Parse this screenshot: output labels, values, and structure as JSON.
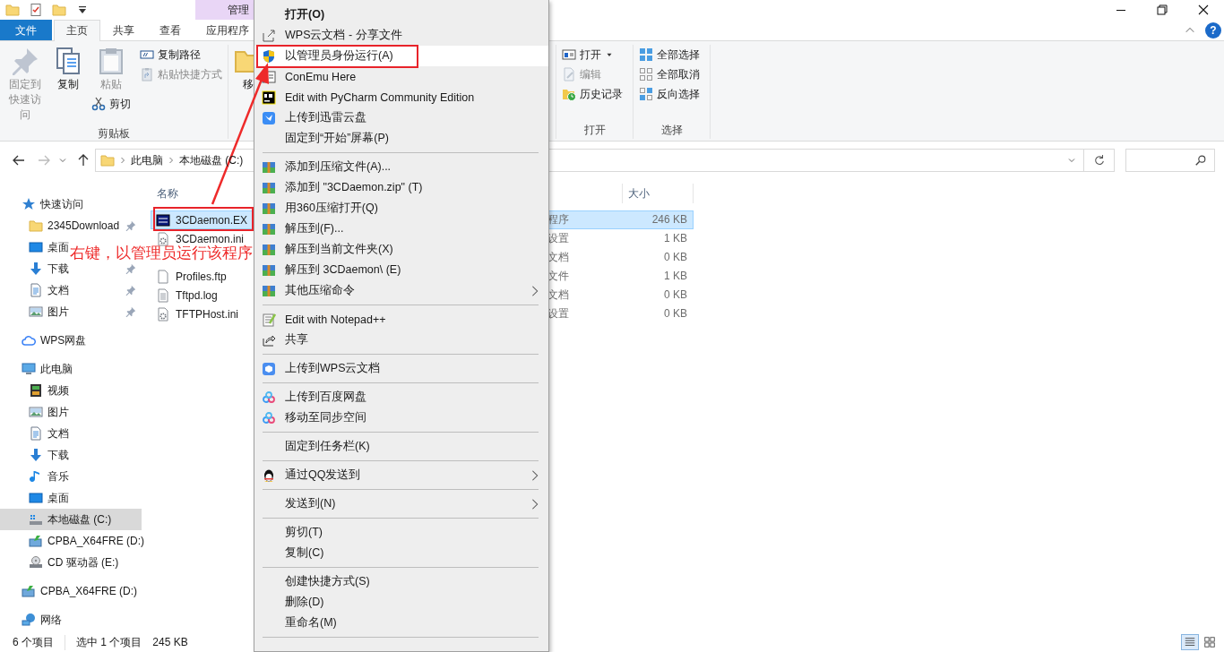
{
  "title_bar": {
    "contextual_tab": "管理"
  },
  "ribbon_tabs": [
    {
      "label": "文件",
      "kind": "file",
      "selected": false
    },
    {
      "label": "主页",
      "kind": "tab",
      "selected": true
    },
    {
      "label": "共享",
      "kind": "tab",
      "selected": false
    },
    {
      "label": "查看",
      "kind": "tab",
      "selected": false
    },
    {
      "label": "应用程序",
      "kind": "tab",
      "selected": false
    }
  ],
  "ribbon_help": {
    "label": "?"
  },
  "ribbon_groups": [
    {
      "label": "剪贴板",
      "columns": [
        [
          {
            "label": "固定到快速访问",
            "kind": "pin",
            "disabled": true
          }
        ],
        [
          {
            "label": "复制",
            "kind": "copy",
            "disabled": false
          }
        ],
        [
          {
            "label": "粘贴",
            "kind": "paste",
            "disabled": true
          },
          {
            "label": "剪切",
            "kind": "cut",
            "disabled": false
          }
        ],
        [
          {
            "label": "复制路径",
            "kind": "copy-path",
            "disabled": false
          },
          {
            "label": "粘贴快捷方式",
            "kind": "paste-shortcut",
            "disabled": true
          }
        ]
      ]
    },
    {
      "columns": [
        [
          {
            "label": "移",
            "kind": "move",
            "disabled": false
          }
        ]
      ]
    },
    {
      "label": "打开",
      "columns": [
        [
          {
            "label": "打开",
            "kind": "open",
            "disabled": false,
            "dropdown": true
          },
          {
            "label": "编辑",
            "kind": "edit",
            "disabled": true,
            "dropdown": false
          },
          {
            "label": "历史记录",
            "kind": "history",
            "disabled": false,
            "dropdown": false
          }
        ]
      ]
    },
    {
      "label": "选择",
      "columns": [
        [
          {
            "label": "全部选择",
            "kind": "select-all",
            "disabled": false
          },
          {
            "label": "全部取消",
            "kind": "select-none",
            "disabled": false
          },
          {
            "label": "反向选择",
            "kind": "invert",
            "disabled": false
          }
        ]
      ]
    }
  ],
  "address_bar": {
    "crumbs": [
      "此电脑",
      "本地磁盘 (C:)"
    ]
  },
  "nav_pane": [
    {
      "label": "快速访问",
      "kind": "star",
      "selected": false,
      "children": [
        {
          "label": "2345Download",
          "kind": "folder",
          "pinned": true,
          "selected": false
        },
        {
          "label": "桌面",
          "kind": "desktop",
          "pinned": false,
          "selected": false
        },
        {
          "label": "下载",
          "kind": "download",
          "pinned": true,
          "selected": false
        },
        {
          "label": "文档",
          "kind": "document",
          "pinned": true,
          "selected": false
        },
        {
          "label": "图片",
          "kind": "image",
          "pinned": true,
          "selected": false
        }
      ]
    },
    {
      "label": "WPS网盘",
      "kind": "cloud",
      "selected": false
    },
    {
      "label": "此电脑",
      "kind": "computer",
      "selected": false,
      "children": [
        {
          "label": "视频",
          "kind": "film",
          "selected": false
        },
        {
          "label": "图片",
          "kind": "image",
          "selected": false
        },
        {
          "label": "文档",
          "kind": "document",
          "selected": false
        },
        {
          "label": "下载",
          "kind": "download",
          "selected": false
        },
        {
          "label": "音乐",
          "kind": "music",
          "selected": false
        },
        {
          "label": "桌面",
          "kind": "desktop",
          "selected": false
        },
        {
          "label": "本地磁盘 (C:)",
          "kind": "drive",
          "selected": true
        },
        {
          "label": "CPBA_X64FRE (D:)",
          "kind": "net-drive",
          "selected": false
        },
        {
          "label": "CD 驱动器 (E:)",
          "kind": "cd",
          "selected": false
        }
      ]
    },
    {
      "label": "CPBA_X64FRE (D:)",
      "kind": "net-drive",
      "selected": false
    },
    {
      "label": "网络",
      "kind": "network",
      "selected": false
    }
  ],
  "file_list": {
    "columns": {
      "name": "名称",
      "size": "大小"
    },
    "rows": [
      {
        "name": "3CDaemon.EX",
        "type": "程序",
        "size": "246 KB",
        "kind": "exe",
        "selected": true
      },
      {
        "name": "3CDaemon.ini",
        "type": "设置",
        "size": "1 KB",
        "kind": "settings",
        "selected": false
      },
      {
        "type": "文档",
        "size": "0 KB",
        "selected": false
      },
      {
        "name": "Profiles.ftp",
        "type": "文件",
        "size": "1 KB",
        "kind": "blank",
        "selected": false
      },
      {
        "name": "Tftpd.log",
        "type": "文档",
        "size": "0 KB",
        "kind": "text",
        "selected": false
      },
      {
        "name": "TFTPHost.ini",
        "type": "设置",
        "size": "0 KB",
        "kind": "settings",
        "selected": false
      }
    ]
  },
  "status_bar": {
    "item_count": "6 个项目",
    "selection": "选中 1 个项目",
    "selection_size": "245 KB",
    "views": [
      {
        "kind": "details",
        "selected": true
      },
      {
        "kind": "large-icons",
        "selected": false
      }
    ]
  },
  "context_menu": [
    {
      "kind": "plain",
      "label": "打开(O)",
      "default": true,
      "selected": false
    },
    {
      "kind": "share-out",
      "label": "WPS云文档 - 分享文件",
      "selected": false
    },
    {
      "kind": "shield",
      "label": "以管理员身份运行(A)",
      "selected": true
    },
    {
      "kind": "console",
      "label": "ConEmu Here",
      "selected": false
    },
    {
      "kind": "pc",
      "label": "Edit with PyCharm Community Edition",
      "selected": false
    },
    {
      "kind": "bird",
      "label": "上传到迅雷云盘",
      "selected": false
    },
    {
      "kind": "plain",
      "label": "固定到“开始”屏幕(P)",
      "selected": false
    },
    {
      "kind": "separator"
    },
    {
      "kind": "archive",
      "label": "添加到压缩文件(A)...",
      "selected": false
    },
    {
      "kind": "archive",
      "label": "添加到 \"3CDaemon.zip\" (T)",
      "selected": false
    },
    {
      "kind": "archive",
      "label": "用360压缩打开(Q)",
      "selected": false
    },
    {
      "kind": "archive",
      "label": "解压到(F)...",
      "selected": false
    },
    {
      "kind": "archive",
      "label": "解压到当前文件夹(X)",
      "selected": false
    },
    {
      "kind": "archive",
      "label": "解压到 3CDaemon\\ (E)",
      "selected": false
    },
    {
      "kind": "archive",
      "label": "其他压缩命令",
      "submenu": true,
      "selected": false
    },
    {
      "kind": "separator"
    },
    {
      "kind": "notepad",
      "label": "Edit with Notepad++",
      "selected": false
    },
    {
      "kind": "share",
      "label": "共享",
      "selected": false
    },
    {
      "kind": "separator"
    },
    {
      "kind": "cube",
      "label": "上传到WPS云文档",
      "selected": false
    },
    {
      "kind": "separator"
    },
    {
      "kind": "rings",
      "label": "上传到百度网盘",
      "selected": false
    },
    {
      "kind": "rings",
      "label": "移动至同步空间",
      "selected": false
    },
    {
      "kind": "separator"
    },
    {
      "kind": "plain",
      "label": "固定到任务栏(K)",
      "selected": false
    },
    {
      "kind": "separator"
    },
    {
      "kind": "penguin",
      "label": "通过QQ发送到",
      "submenu": true,
      "selected": false
    },
    {
      "kind": "separator"
    },
    {
      "kind": "plain",
      "label": "发送到(N)",
      "submenu": true,
      "selected": false
    },
    {
      "kind": "separator"
    },
    {
      "kind": "plain",
      "label": "剪切(T)",
      "selected": false
    },
    {
      "kind": "plain",
      "label": "复制(C)",
      "selected": false
    },
    {
      "kind": "separator"
    },
    {
      "kind": "plain",
      "label": "创建快捷方式(S)",
      "selected": false
    },
    {
      "kind": "plain",
      "label": "删除(D)",
      "selected": false
    },
    {
      "kind": "plain",
      "label": "重命名(M)",
      "selected": false
    },
    {
      "kind": "separator"
    }
  ],
  "annotation": {
    "text": "右键，以管理员运行该程序"
  }
}
